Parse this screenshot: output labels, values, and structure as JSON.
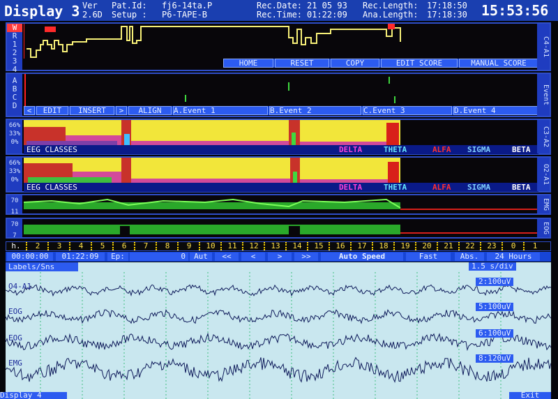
{
  "header": {
    "display_title": "Display 3",
    "version_label": "Ver",
    "version": "2.6D",
    "pat_id_label": "Pat.Id:",
    "pat_id": "fj6-14ta.P",
    "setup_label": "Setup :",
    "setup": "P6-TAPE-B",
    "rec_date_label": "Rec.Date:",
    "rec_date": "21 05 93",
    "rec_length_label": "Rec.Length:",
    "rec_length": "17:18:50",
    "rec_time_label": "Rec.Time:",
    "rec_time": "01:22:09",
    "ana_length_label": "Ana.Length:",
    "ana_length": "17:18:30",
    "clock": "15:53:56"
  },
  "hypnogram": {
    "left_tags": [
      "W",
      "R",
      "1",
      "2",
      "3",
      "4"
    ],
    "right_tag": "C4-A1",
    "buttons": [
      "HOME",
      "RESET",
      "COPY",
      "EDIT SCORE",
      "MANUAL SCORE"
    ]
  },
  "events": {
    "left_tags": [
      "A",
      "B",
      "C",
      "D"
    ],
    "right_tag": "Event",
    "buttons": [
      "<",
      "EDIT",
      "INSERT",
      ">",
      "ALIGN",
      "A.Event   1",
      "B.Event   2",
      "C.Event   3",
      "D.Event   4"
    ]
  },
  "spectra": [
    {
      "right_tag": "C3-A2",
      "scale": [
        "66%",
        "33%",
        "0%"
      ],
      "class_label": "EEG CLASSES"
    },
    {
      "right_tag": "O2-A1",
      "scale": [
        "66%",
        "33%",
        "0%"
      ],
      "class_label": "EEG CLASSES"
    }
  ],
  "eeg_classes": [
    {
      "name": "DELTA",
      "color": "#ff3fd8"
    },
    {
      "name": "THETA",
      "color": "#66e8ff"
    },
    {
      "name": "ALFA",
      "color": "#ff3030"
    },
    {
      "name": "SIGMA",
      "color": "#7fd0ff"
    },
    {
      "name": "BETA",
      "color": "#ffffff"
    }
  ],
  "emg": {
    "right_tag": "EMG",
    "scale": [
      "70",
      "11"
    ]
  },
  "eog": {
    "right_tag": "EOG",
    "scale": [
      "70",
      "7"
    ]
  },
  "hours": {
    "label": "h.",
    "ticks": [
      "2",
      "3",
      "4",
      "5",
      "6",
      "7",
      "8",
      "9",
      "10",
      "11",
      "12",
      "13",
      "14",
      "15",
      "16",
      "17",
      "18",
      "19",
      "20",
      "21",
      "22",
      "23",
      "0",
      "1"
    ]
  },
  "controls": {
    "elapsed": "00:00:00",
    "time": "01:22:09",
    "ep_label": "Ep:",
    "ep_value": "0",
    "aut": "Aut",
    "nav": [
      "<<",
      "<",
      ">",
      ">>"
    ],
    "auto_speed": "Auto Speed",
    "fast": "Fast",
    "abs": "Abs.",
    "range": "24 Hours"
  },
  "eeg_view": {
    "labels_header": "Labels/Sns",
    "timebase": "1.5 s/div",
    "channels": [
      {
        "label": "O4-A1",
        "gain": "2:100uV"
      },
      {
        "label": "EOG",
        "gain": "5:100uV"
      },
      {
        "label": "EOG",
        "gain": "6:100uV"
      },
      {
        "label": "EMG",
        "gain": "8:120uV"
      }
    ]
  },
  "bottom": {
    "display": "Display 4",
    "exit": "Exit"
  },
  "colors": {
    "frame_blue": "#2f4ec9",
    "hypnogram_yellow": "#f7f078",
    "spectrum_yellow": "#f2e63a",
    "emg_green": "#3fd83f",
    "eeg_background": "#c9e7ef",
    "hour_marks": "#ffd800"
  }
}
